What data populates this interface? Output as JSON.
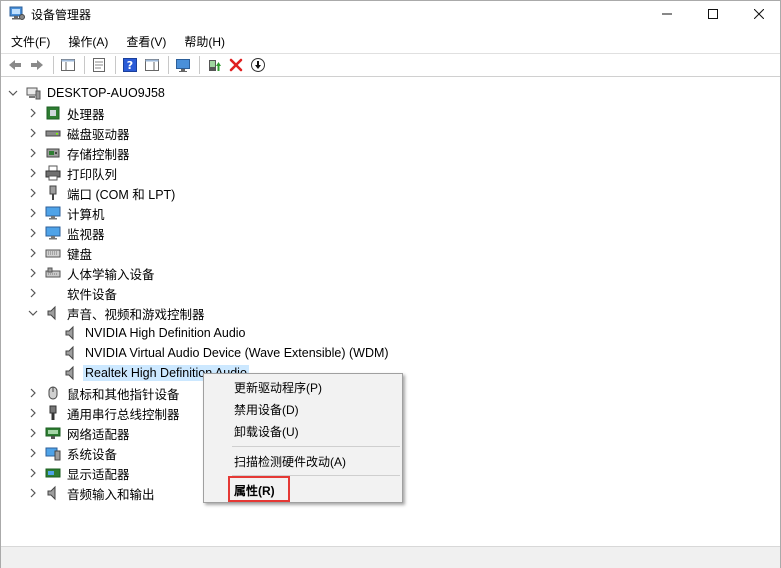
{
  "window": {
    "title": "设备管理器"
  },
  "menu": [
    "文件(F)",
    "操作(A)",
    "查看(V)",
    "帮助(H)"
  ],
  "tree": {
    "root": "DESKTOP-AUO9J58",
    "categories": [
      {
        "label": "处理器",
        "icon": "cpu-icon"
      },
      {
        "label": "磁盘驱动器",
        "icon": "disk-drive-icon"
      },
      {
        "label": "存储控制器",
        "icon": "storage-controller-icon"
      },
      {
        "label": "打印队列",
        "icon": "printer-icon"
      },
      {
        "label": "端口 (COM 和 LPT)",
        "icon": "port-icon"
      },
      {
        "label": "计算机",
        "icon": "computer-icon"
      },
      {
        "label": "监视器",
        "icon": "monitor-icon"
      },
      {
        "label": "键盘",
        "icon": "keyboard-icon"
      },
      {
        "label": "人体学输入设备",
        "icon": "hid-icon"
      },
      {
        "label": "软件设备",
        "icon": "software-device-icon"
      },
      {
        "label": "声音、视频和游戏控制器",
        "icon": "speaker-icon"
      }
    ],
    "audio_children": [
      "NVIDIA High Definition Audio",
      "NVIDIA Virtual Audio Device (Wave Extensible) (WDM)",
      "Realtek High Definition Audio"
    ],
    "categories_after": [
      {
        "label": "鼠标和其他指针设备",
        "icon": "mouse-icon"
      },
      {
        "label": "通用串行总线控制器",
        "icon": "usb-icon"
      },
      {
        "label": "网络适配器",
        "icon": "network-icon"
      },
      {
        "label": "系统设备",
        "icon": "system-device-icon"
      },
      {
        "label": "显示适配器",
        "icon": "display-adapter-icon"
      },
      {
        "label": "音频输入和输出",
        "icon": "audio-io-icon"
      }
    ]
  },
  "context_menu": {
    "update_driver": "更新驱动程序(P)",
    "disable": "禁用设备(D)",
    "uninstall": "卸载设备(U)",
    "scan": "扫描检测硬件改动(A)",
    "properties": "属性(R)"
  },
  "colors": {
    "selection": "#cce8ff",
    "highlight_box": "#e53935",
    "delete_red": "#e02020",
    "help_blue": "#2a5bd7"
  }
}
